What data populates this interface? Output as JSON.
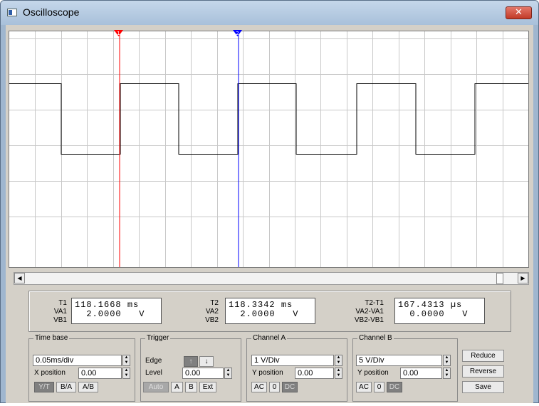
{
  "window": {
    "title": "Oscilloscope",
    "close_glyph": "✕"
  },
  "cursors": {
    "t1_label": "1",
    "t2_label": "2",
    "t1_color": "#ff0000",
    "t2_color": "#0000ff"
  },
  "screen": {
    "grid_color": "#c8c8c8",
    "trace_color": "#000000"
  },
  "readout": {
    "t1": {
      "label": "T1",
      "va_label": "VA1",
      "vb_label": "VB1",
      "time": "118.1668",
      "time_unit": "ms",
      "va": "2.0000",
      "va_unit": "V"
    },
    "t2": {
      "label": "T2",
      "va_label": "VA2",
      "vb_label": "VB2",
      "time": "118.3342",
      "time_unit": "ms",
      "va": "2.0000",
      "va_unit": "V"
    },
    "delta": {
      "label": "T2-T1",
      "va_label": "VA2-VA1",
      "vb_label": "VB2-VB1",
      "time": "167.4313",
      "time_unit": "µs",
      "va": "0.0000",
      "va_unit": "V"
    }
  },
  "timebase": {
    "title": "Time base",
    "scale": "0.05ms/div",
    "xpos_label": "X position",
    "xpos": "0.00",
    "modes": [
      "Y/T",
      "B/A",
      "A/B"
    ]
  },
  "trigger": {
    "title": "Trigger",
    "edge_label": "Edge",
    "edge_rise": "↑",
    "edge_fall": "↓",
    "level_label": "Level",
    "level": "0.00",
    "sources": [
      "Auto",
      "A",
      "B",
      "Ext"
    ]
  },
  "channel_a": {
    "title": "Channel A",
    "scale": "1 V/Div",
    "ypos_label": "Y position",
    "ypos": "0.00",
    "coupling": [
      "AC",
      "0",
      "DC"
    ]
  },
  "channel_b": {
    "title": "Channel B",
    "scale": "5 V/Div",
    "ypos_label": "Y position",
    "ypos": "0.00",
    "coupling": [
      "AC",
      "0",
      "DC"
    ]
  },
  "actions": {
    "reduce": "Reduce",
    "reverse": "Reverse",
    "save": "Save"
  },
  "icons": {
    "app": "oscilloscope-icon",
    "scroll_left": "◀",
    "scroll_right": "▶",
    "spin_up": "▲",
    "spin_down": "▼"
  }
}
